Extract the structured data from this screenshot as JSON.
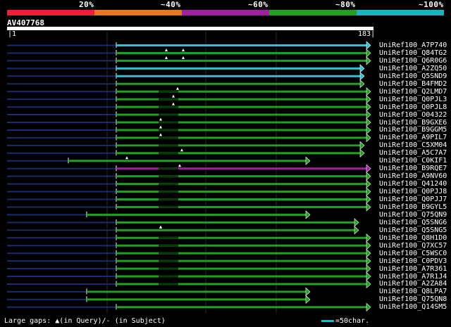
{
  "scale": {
    "labels": [
      "20%",
      "~40%",
      "~60%",
      "~80%",
      "~100%"
    ],
    "colors": [
      "#e8203a",
      "#e87820",
      "#a020a0",
      "#20a020",
      "#20b0c0"
    ]
  },
  "query": {
    "id": "AV407768",
    "start": "1",
    "end": "183"
  },
  "hits": [
    {
      "name": "UniRef100_A7P740",
      "color": "#30c0d0"
    },
    {
      "name": "UniRef100_Q84TG2",
      "color": "#20a020"
    },
    {
      "name": "UniRef100_Q6R0G6",
      "color": "#20a020"
    },
    {
      "name": "UniRef100_A2ZQ50",
      "color": "#30c0d0"
    },
    {
      "name": "UniRef100_Q5SND9",
      "color": "#30c0d0"
    },
    {
      "name": "UniRef100_B4FMD2",
      "color": "#20a020"
    },
    {
      "name": "UniRef100_Q2LMD7",
      "color": "#20a020"
    },
    {
      "name": "UniRef100_Q0PJL3",
      "color": "#20a020"
    },
    {
      "name": "UniRef100_Q0PJL8",
      "color": "#20a020"
    },
    {
      "name": "UniRef100_O04322",
      "color": "#20a020"
    },
    {
      "name": "UniRef100_B9GXE6",
      "color": "#20a020"
    },
    {
      "name": "UniRef100_B9GGM5",
      "color": "#20a020"
    },
    {
      "name": "UniRef100_A9PIL7",
      "color": "#20a020"
    },
    {
      "name": "UniRef100_C5XM04",
      "color": "#20a020"
    },
    {
      "name": "UniRef100_A5C7A7",
      "color": "#20a020"
    },
    {
      "name": "UniRef100_C0KIF1",
      "color": "#20a020"
    },
    {
      "name": "UniRef100_B9RQE7",
      "color": "#a020a0"
    },
    {
      "name": "UniRef100_A9NV60",
      "color": "#20a020"
    },
    {
      "name": "UniRef100_Q41240",
      "color": "#20a020"
    },
    {
      "name": "UniRef100_Q0PJJ8",
      "color": "#20a020"
    },
    {
      "name": "UniRef100_Q0PJJ7",
      "color": "#20a020"
    },
    {
      "name": "UniRef100_B9GYL5",
      "color": "#20a020"
    },
    {
      "name": "UniRef100_Q75QN9",
      "color": "#20a020"
    },
    {
      "name": "UniRef100_Q5SNG6",
      "color": "#20a020"
    },
    {
      "name": "UniRef100_Q5SNG5",
      "color": "#20a020"
    },
    {
      "name": "UniRef100_Q8H1D0",
      "color": "#20a020"
    },
    {
      "name": "UniRef100_Q7XC57",
      "color": "#20a020"
    },
    {
      "name": "UniRef100_C5WSC0",
      "color": "#20a020"
    },
    {
      "name": "UniRef100_C0PDV3",
      "color": "#20a020"
    },
    {
      "name": "UniRef100_A7R361",
      "color": "#20a020"
    },
    {
      "name": "UniRef100_A7R1J4",
      "color": "#20a020"
    },
    {
      "name": "UniRef100_A2ZA84",
      "color": "#20a020"
    },
    {
      "name": "UniRef100_Q8LPA7",
      "color": "#20a020"
    },
    {
      "name": "UniRef100_Q75QN8",
      "color": "#20a020"
    },
    {
      "name": "UniRef100_Q14SM5",
      "color": "#20a020"
    }
  ],
  "footer": {
    "gaps_prefix": "Large gaps:",
    "gaps_query": "(in Query)/",
    "gaps_subject": "- (in Subject)",
    "scale_text": "=50char."
  }
}
